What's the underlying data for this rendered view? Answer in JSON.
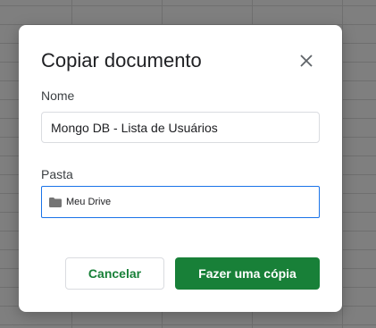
{
  "dialog": {
    "title": "Copiar documento",
    "close_icon": "close-icon",
    "name_label": "Nome",
    "name_value": "Mongo DB - Lista de Usuários",
    "folder_label": "Pasta",
    "folder_icon": "folder-icon",
    "folder_value": "Meu Drive",
    "cancel_label": "Cancelar",
    "copy_label": "Fazer uma cópia"
  },
  "colors": {
    "accent_green": "#188038",
    "focus_blue": "#1a73e8",
    "backdrop": "#7f7f7f"
  }
}
